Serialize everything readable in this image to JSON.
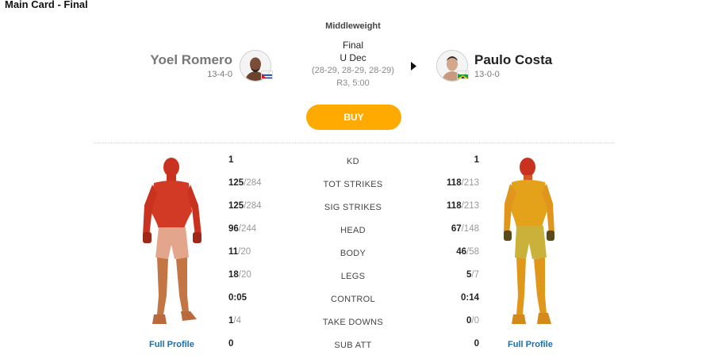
{
  "card_title": "Main Card - Final",
  "weight_class": "Middleweight",
  "fighter_left": {
    "name": "Yoel Romero",
    "record": "13-4-0",
    "flag": "cuba-flag-icon",
    "profile_link": "Full Profile",
    "silhouette_color": "#d23a25"
  },
  "fighter_right": {
    "name": "Paulo Costa",
    "record": "13-0-0",
    "flag": "brazil-flag-icon",
    "profile_link": "Full Profile",
    "silhouette_color": "#e4a21b"
  },
  "result": {
    "status": "Final",
    "method": "U Dec",
    "scores": "(28-29, 28-29, 28-29)",
    "round_time": "R3, 5:00",
    "winner_indicator": "right"
  },
  "buy_label": "BUY",
  "stats": [
    {
      "label": "KD",
      "left_value": "1",
      "left_total": "",
      "right_value": "1",
      "right_total": ""
    },
    {
      "label": "TOT STRIKES",
      "left_value": "125",
      "left_total": "/284",
      "right_value": "118",
      "right_total": "/213"
    },
    {
      "label": "SIG STRIKES",
      "left_value": "125",
      "left_total": "/284",
      "right_value": "118",
      "right_total": "/213"
    },
    {
      "label": "HEAD",
      "left_value": "96",
      "left_total": "/244",
      "right_value": "67",
      "right_total": "/148"
    },
    {
      "label": "BODY",
      "left_value": "11",
      "left_total": "/20",
      "right_value": "46",
      "right_total": "/58"
    },
    {
      "label": "LEGS",
      "left_value": "18",
      "left_total": "/20",
      "right_value": "5",
      "right_total": "/7"
    },
    {
      "label": "CONTROL",
      "left_value": "0:05",
      "left_total": "",
      "right_value": "0:14",
      "right_total": ""
    },
    {
      "label": "TAKE DOWNS",
      "left_value": "1",
      "left_total": "/4",
      "right_value": "0",
      "right_total": "/0"
    },
    {
      "label": "SUB ATT",
      "left_value": "0",
      "left_total": "",
      "right_value": "0",
      "right_total": ""
    }
  ]
}
